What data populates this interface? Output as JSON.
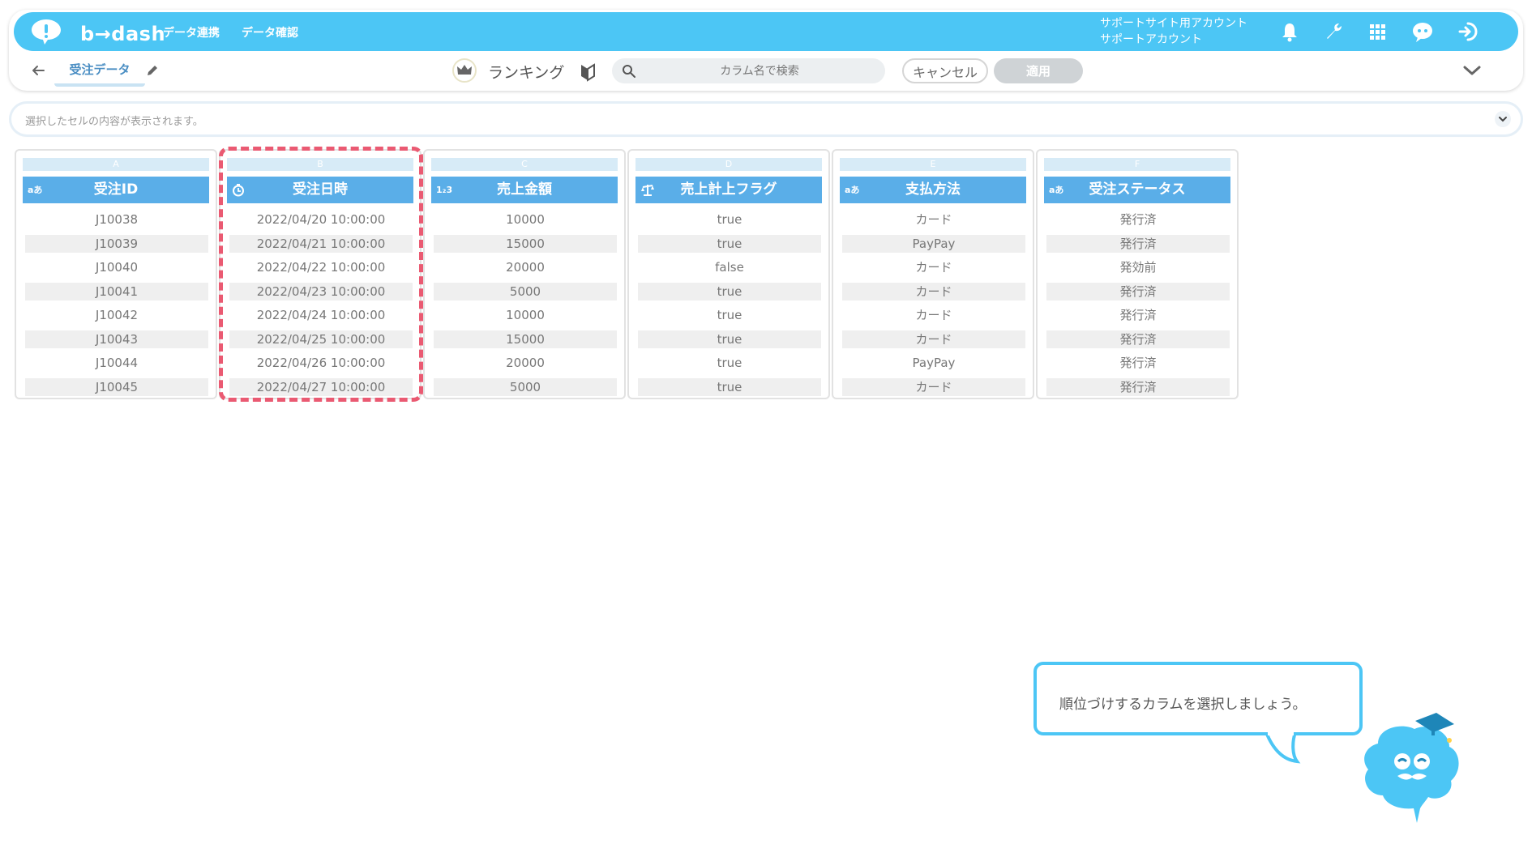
{
  "header": {
    "logo_text": "b→dash",
    "nav": [
      "データ連携",
      "データ確認"
    ],
    "account_line1": "サポートサイト用アカウント",
    "account_line2": "サポートアカウント",
    "icons": [
      "bell-icon",
      "wrench-icon",
      "grid-icon",
      "chat-icon",
      "logout-icon"
    ]
  },
  "toolbar": {
    "title": "受注データ",
    "mode_label": "ランキング",
    "search_placeholder": "カラム名で検索",
    "cancel_label": "キャンセル",
    "apply_label": "適用"
  },
  "cellbar": {
    "text": "選択したセルの内容が表示されます。"
  },
  "colors": {
    "brand": "#4cc6f5",
    "column_header": "#5aaee8",
    "highlight": "#ea5a72"
  },
  "columns": [
    {
      "letter": "A",
      "name": "受注ID",
      "type": "a‎あ",
      "type_icon": "text-type-icon",
      "cells": [
        "J10038",
        "J10039",
        "J10040",
        "J10041",
        "J10042",
        "J10043",
        "J10044",
        "J10045"
      ]
    },
    {
      "letter": "B",
      "name": "受注日時",
      "type": "",
      "type_icon": "clock-type-icon",
      "cells": [
        "2022/04/20 10:00:00",
        "2022/04/21 10:00:00",
        "2022/04/22 10:00:00",
        "2022/04/23 10:00:00",
        "2022/04/24 10:00:00",
        "2022/04/25 10:00:00",
        "2022/04/26 10:00:00",
        "2022/04/27 10:00:00"
      ]
    },
    {
      "letter": "C",
      "name": "売上金額",
      "type": "1₂3",
      "type_icon": "number-type-icon",
      "cells": [
        "10000",
        "15000",
        "20000",
        "5000",
        "10000",
        "15000",
        "20000",
        "5000"
      ]
    },
    {
      "letter": "D",
      "name": "売上計上フラグ",
      "type": "",
      "type_icon": "scale-type-icon",
      "cells": [
        "true",
        "true",
        "false",
        "true",
        "true",
        "true",
        "true",
        "true"
      ]
    },
    {
      "letter": "E",
      "name": "支払方法",
      "type": "a‎あ",
      "type_icon": "text-type-icon",
      "cells": [
        "カード",
        "PayPay",
        "カード",
        "カード",
        "カード",
        "カード",
        "PayPay",
        "カード"
      ]
    },
    {
      "letter": "F",
      "name": "受注ステータス",
      "type": "a‎あ",
      "type_icon": "text-type-icon",
      "cells": [
        "発行済",
        "発行済",
        "発効前",
        "発行済",
        "発行済",
        "発行済",
        "発行済",
        "発行済"
      ]
    }
  ],
  "guide": {
    "message": "順位づけするカラムを選択しましょう。"
  }
}
